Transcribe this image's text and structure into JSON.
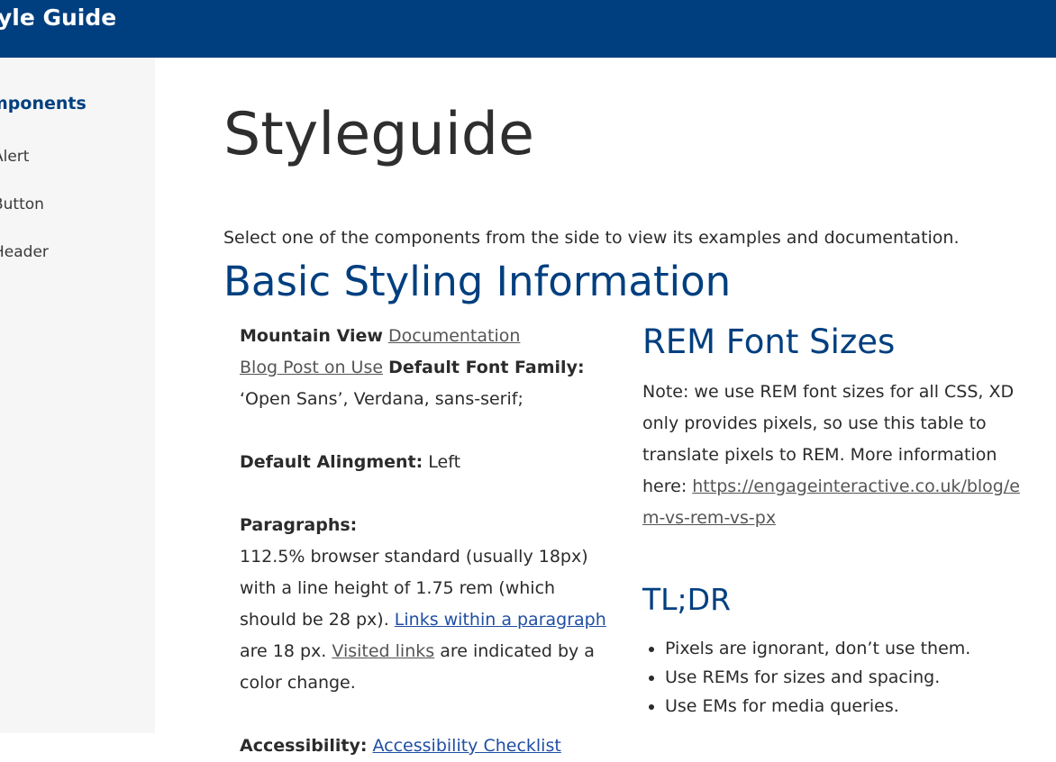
{
  "header": {
    "title": "Style Guide"
  },
  "sidebar": {
    "heading": "Components",
    "items": [
      {
        "label": "Alert"
      },
      {
        "label": "Button"
      },
      {
        "label": "Header"
      }
    ]
  },
  "main": {
    "title": "Styleguide",
    "intro": "Select one of the components from the side to view its examples and documentation.",
    "section_heading": "Basic Styling Information",
    "left": {
      "mountain_view_label": "Mountain View",
      "documentation_link": "Documentation",
      "blog_link": "Blog Post on Use",
      "font_family_label": "Default Font Family:",
      "font_family_value": "‘Open Sans’, Verdana, sans-serif;",
      "alignment_label": "Default Alingment:",
      "alignment_value": "Left",
      "paragraphs_label": "Paragraphs:",
      "paragraphs_text": "112.5% browser standard (usually 18px) with a line height of 1.75 rem (which should be 28 px).",
      "links_within_link": "Links within a paragraph",
      "links_size_text": "are 18 px.",
      "visited_link": "Visited links",
      "visited_text": "are indicated by a color change.",
      "accessibility_label": "Accessibility:",
      "accessibility_link": "Accessibility Checklist"
    },
    "right": {
      "rem_heading": "REM Font Sizes",
      "rem_note": "Note: we use REM font sizes for all CSS, XD only provides pixels, so use this table to translate pixels to REM. More information here:",
      "rem_link": "https://engageinteractive.co.uk/blog/em-vs-rem-vs-px",
      "tldr_heading": "TL;DR",
      "tldr_items": [
        "Pixels are ignorant, don’t use them.",
        "Use REMs for sizes and spacing.",
        "Use EMs for media queries."
      ]
    }
  },
  "colors": {
    "header_bg": "#003f7f",
    "heading_blue": "#003f7f",
    "link_blue": "#1f4ea3",
    "sidebar_bg": "#f6f6f6"
  }
}
